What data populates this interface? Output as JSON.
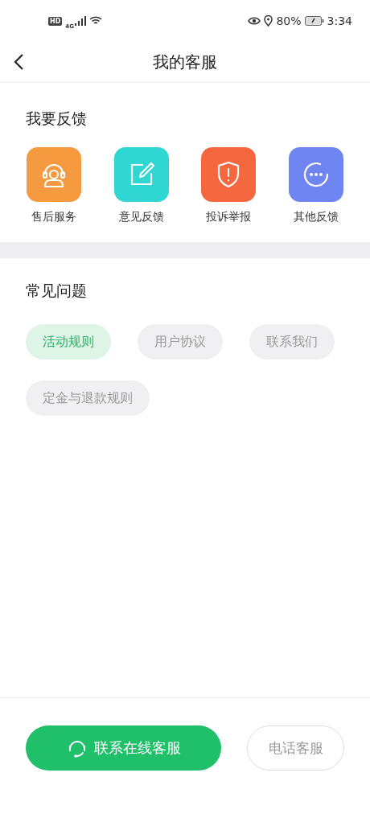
{
  "status_bar": {
    "hd": "HD",
    "network": "4G",
    "battery_percent": "80%",
    "time": "3:34"
  },
  "header": {
    "title": "我的客服"
  },
  "feedback": {
    "title": "我要反馈",
    "items": [
      {
        "label": "售后服务",
        "kind": "headset",
        "color": "#f59a3e"
      },
      {
        "label": "意见反馈",
        "kind": "edit",
        "color": "#2fd6d2"
      },
      {
        "label": "投诉举报",
        "kind": "shield",
        "color": "#f4673f"
      },
      {
        "label": "其他反馈",
        "kind": "more",
        "color": "#6f86f2"
      }
    ]
  },
  "faq": {
    "title": "常见问题",
    "chips": [
      {
        "label": "活动规则",
        "selected": true
      },
      {
        "label": "用户协议",
        "selected": false
      },
      {
        "label": "联系我们",
        "selected": false
      },
      {
        "label": "定金与退款规则",
        "selected": false
      }
    ]
  },
  "bottom": {
    "online_button": "联系在线客服",
    "phone_button": "电话客服"
  }
}
